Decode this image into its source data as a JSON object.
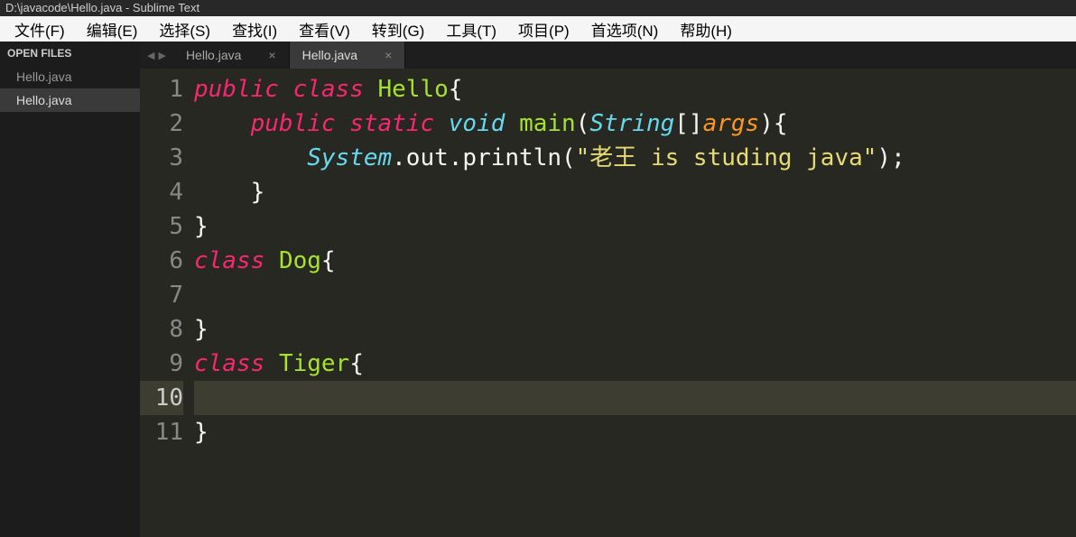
{
  "title": "D:\\javacode\\Hello.java - Sublime Text",
  "menu": [
    "文件(F)",
    "编辑(E)",
    "选择(S)",
    "查找(I)",
    "查看(V)",
    "转到(G)",
    "工具(T)",
    "项目(P)",
    "首选项(N)",
    "帮助(H)"
  ],
  "sidebar": {
    "title": "OPEN FILES",
    "files": [
      "Hello.java",
      "Hello.java"
    ],
    "active": 1
  },
  "tabs": {
    "items": [
      "Hello.java",
      "Hello.java"
    ],
    "active": 1
  },
  "code": {
    "current_line": 10,
    "tokens": [
      [
        [
          "kw",
          "public"
        ],
        [
          "plain",
          " "
        ],
        [
          "kw",
          "class"
        ],
        [
          "plain",
          " "
        ],
        [
          "cname",
          "Hello"
        ],
        [
          "plain",
          "{"
        ]
      ],
      [
        [
          "plain",
          "    "
        ],
        [
          "kw",
          "public"
        ],
        [
          "plain",
          " "
        ],
        [
          "kw-static",
          "static"
        ],
        [
          "plain",
          " "
        ],
        [
          "type",
          "void"
        ],
        [
          "plain",
          " "
        ],
        [
          "fname",
          "main"
        ],
        [
          "plain",
          "("
        ],
        [
          "type",
          "String"
        ],
        [
          "plain",
          "[]"
        ],
        [
          "param",
          "args"
        ],
        [
          "plain",
          "){"
        ]
      ],
      [
        [
          "plain",
          "        "
        ],
        [
          "type",
          "System"
        ],
        [
          "plain",
          ".out.println("
        ],
        [
          "str",
          "\"老王 is studing java\""
        ],
        [
          "plain",
          ");"
        ]
      ],
      [
        [
          "plain",
          "    }"
        ]
      ],
      [
        [
          "plain",
          "}"
        ]
      ],
      [
        [
          "kw",
          "class"
        ],
        [
          "plain",
          " "
        ],
        [
          "cname",
          "Dog"
        ],
        [
          "plain",
          "{"
        ]
      ],
      [],
      [
        [
          "plain",
          "}"
        ]
      ],
      [
        [
          "kw",
          "class"
        ],
        [
          "plain",
          " "
        ],
        [
          "cname",
          "Tiger"
        ],
        [
          "plain",
          "{"
        ]
      ],
      [],
      [
        [
          "plain",
          "}"
        ]
      ]
    ]
  }
}
